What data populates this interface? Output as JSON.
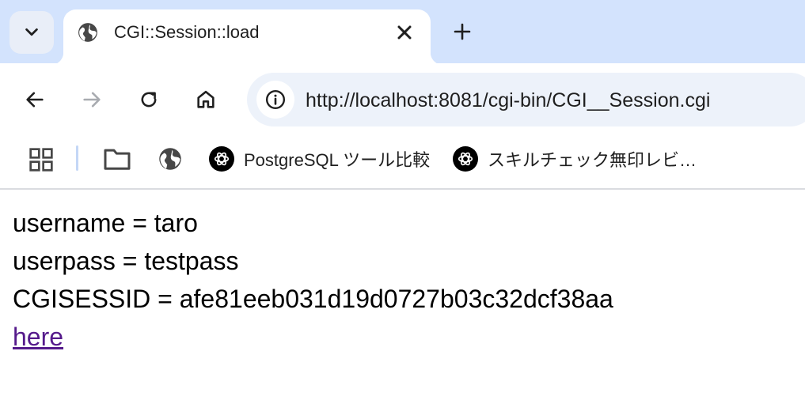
{
  "browser": {
    "tab": {
      "title": "CGI::Session::load"
    },
    "address_bar": {
      "url": "http://localhost:8081/cgi-bin/CGI__Session.cgi"
    },
    "bookmarks": [
      {
        "label": "PostgreSQL ツール比較",
        "icon": "openai-icon"
      },
      {
        "label": "スキルチェック無印レビ…",
        "icon": "openai-icon"
      }
    ]
  },
  "page": {
    "lines": [
      "username = taro",
      "userpass = testpass",
      "CGISESSID = afe81eeb031d19d0727b03c32dcf38aa"
    ],
    "link_text": "here",
    "link_color": "#551a8b"
  },
  "colors": {
    "tabstrip": "#d3e3fd",
    "omnibox": "#edf2fa"
  }
}
